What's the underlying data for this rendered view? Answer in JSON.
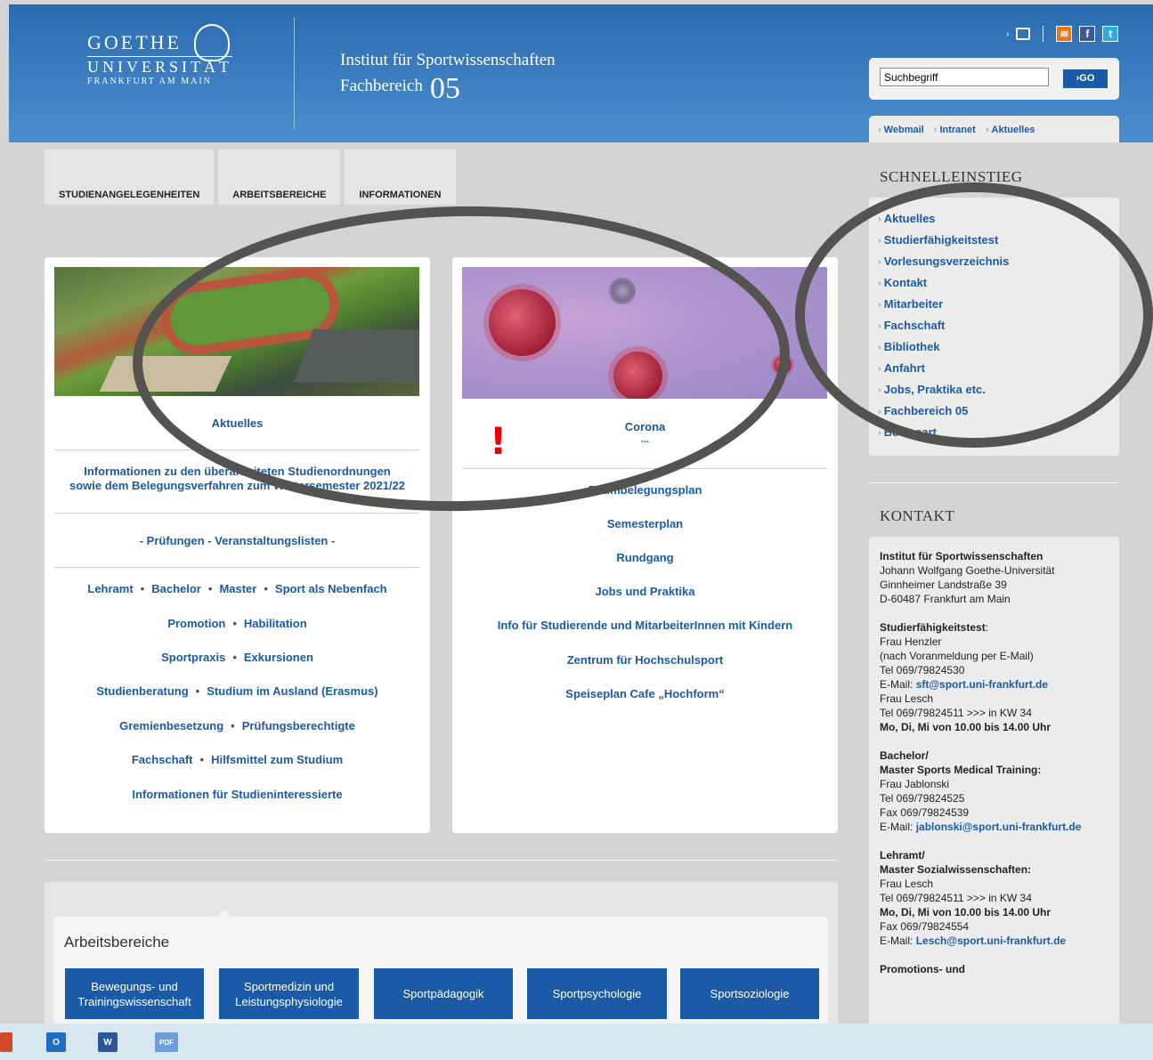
{
  "header": {
    "logo_line1": "GOETHE",
    "logo_line2": "UNIVERSITÄT",
    "logo_line3": "FRANKFURT AM MAIN",
    "institute": "Institut für Sportwissenschaften",
    "faculty": "Fachbereich",
    "faculty_number": "05",
    "search_value": "Suchbegriff",
    "go_label": "›GO",
    "quicklinks": [
      "Webmail",
      "Intranet",
      "Aktuelles"
    ]
  },
  "nav": [
    "STUDIENANGELEGENHEITEN",
    "ARBEITSBEREICHE",
    "INFORMATIONEN"
  ],
  "left_card": {
    "aktuelles": "Aktuelles",
    "info_line1": "Informationen zu den überarbeiteten Studienordnungen",
    "info_line2": "sowie dem Belegungsverfahren zum Wintersemester 2021/22",
    "pruefungen": "- Prüfungen - Veranstaltungslisten -",
    "rows": [
      [
        "Lehramt",
        "Bachelor",
        "Master",
        "Sport als Nebenfach"
      ],
      [
        "Promotion",
        "Habilitation"
      ],
      [
        "Sportpraxis",
        "Exkursionen"
      ],
      [
        "Studienberatung",
        "Studium im Ausland (Erasmus)"
      ],
      [
        "Gremienbesetzung",
        "Prüfungsberechtigte"
      ],
      [
        "Fachschaft",
        "Hilfsmittel zum Studium"
      ],
      [
        "Informationen für Studieninteressierte"
      ]
    ]
  },
  "right_card": {
    "corona": "Corona",
    "ellipsis": "...",
    "exclaim": "!",
    "links": [
      "Raumbelegungsplan",
      "Semesterplan",
      "Rundgang",
      "Jobs und Praktika",
      "Info für Studierende und MitarbeiterInnen mit Kindern",
      "Zentrum für Hochschulsport",
      "Speiseplan Cafe „Hochform“"
    ]
  },
  "schnelleinstieg": {
    "heading": "SCHNELLEINSTIEG",
    "items": [
      "Aktuelles",
      "Studierfähigkeitstest",
      "Vorlesungsverzeichnis",
      "Kontakt",
      "Mitarbeiter",
      "Fachschaft",
      "Bibliothek",
      "Anfahrt",
      "Jobs, Praktika etc.",
      "Fachbereich 05",
      "Besinsart"
    ]
  },
  "kontakt": {
    "heading": "KONTAKT",
    "inst_name": "Institut für Sportwissenschaften",
    "inst_lines": [
      "Johann Wolfgang Goethe-Universität",
      "Ginnheimer Landstraße 39",
      "D-60487 Frankfurt am Main"
    ],
    "sft_title": "Studierfähigkeitstest",
    "sft_lines": [
      "Frau Henzler",
      "(nach Voranmeldung per E-Mail)",
      "Tel 069/79824530"
    ],
    "sft_email_label": "E-Mail:",
    "sft_email": "sft@sport.uni-frankfurt.de",
    "sft_lines2": [
      "Frau Lesch",
      "Tel 069/79824511 >>> in KW 34"
    ],
    "sft_hours": "Mo, Di, Mi von 10.00 bis 14.00 Uhr",
    "bach_title1": "Bachelor/",
    "bach_title2": "Master Sports Medical Training:",
    "bach_lines": [
      "Frau Jablonski",
      "Tel  069/79824525",
      "Fax 069/79824539"
    ],
    "bach_email_label": "E-Mail:",
    "bach_email": "jablonski@sport.uni-frankfurt.de",
    "lehr_title1": "Lehramt/",
    "lehr_title2": "Master Sozialwissenschaften:",
    "lehr_lines": [
      "Frau Lesch",
      "Tel  069/79824511  >>>  in KW 34"
    ],
    "lehr_hours": "Mo, Di, Mi von 10.00 bis 14.00 Uhr",
    "lehr_fax": "Fax 069/79824554",
    "lehr_email_label": "E-Mail:",
    "lehr_email": "Lesch@sport.uni-frankfurt.de",
    "promo": "Promotions- und"
  },
  "arbeitsbereiche": {
    "title": "Arbeitsbereiche",
    "buttons": [
      "Bewegungs- und Trainingswissenschaft",
      "Sportmedizin und Leistungsphysiologie",
      "Sportpädagogik",
      "Sportpsychologie",
      "Sportsoziologie"
    ]
  },
  "taskbar": [
    "O",
    "W",
    "PDF"
  ]
}
